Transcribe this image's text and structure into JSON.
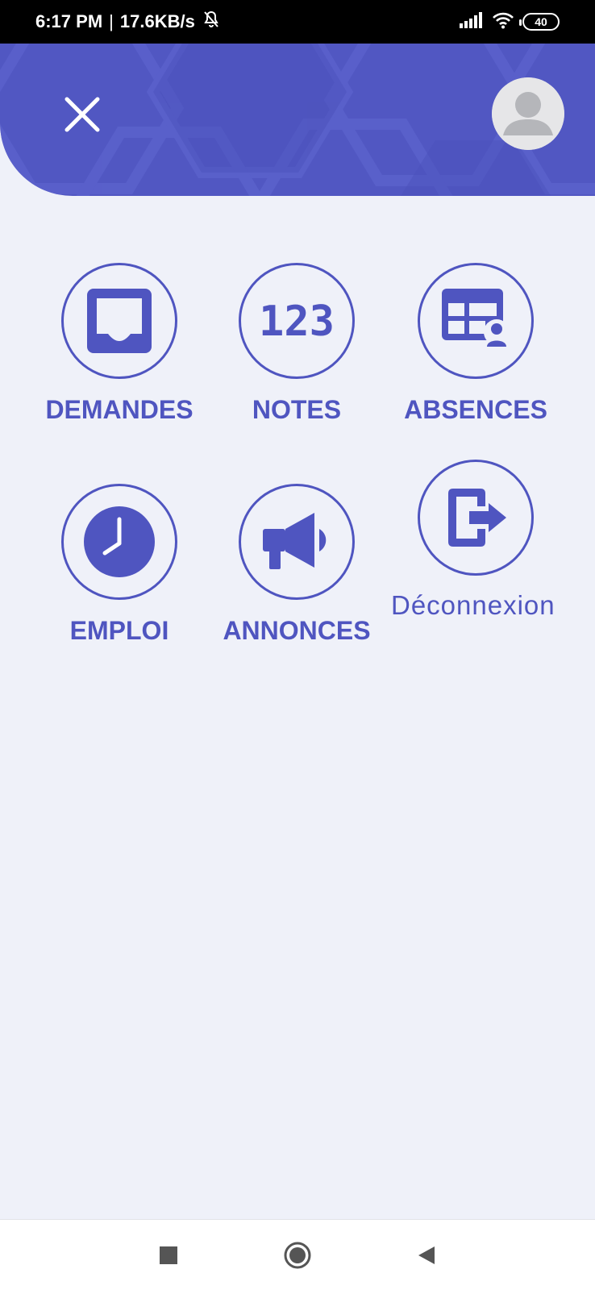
{
  "status_bar": {
    "time": "6:17 PM",
    "separator": "|",
    "speed": "17.6KB/s",
    "battery": "40",
    "icons": [
      "bell-off-icon",
      "signal-icon",
      "wifi-icon",
      "battery-icon"
    ]
  },
  "header": {
    "close_icon": "close-icon",
    "avatar_icon": "user-avatar-icon",
    "color": "#5157c2"
  },
  "menu": {
    "items": [
      {
        "label": "DEMANDES",
        "icon": "inbox-icon"
      },
      {
        "label": "NOTES",
        "icon": "numbers-123-icon"
      },
      {
        "label": "ABSENCES",
        "icon": "table-user-icon"
      },
      {
        "label": "EMPLOI",
        "icon": "clock-icon"
      },
      {
        "label": "ANNONCES",
        "icon": "megaphone-icon"
      },
      {
        "label": "Déconnexion",
        "icon": "logout-icon"
      }
    ],
    "accent": "#4f55c0"
  },
  "nav_bar": {
    "icons": [
      "recents-square-icon",
      "home-circle-icon",
      "back-triangle-icon"
    ]
  }
}
